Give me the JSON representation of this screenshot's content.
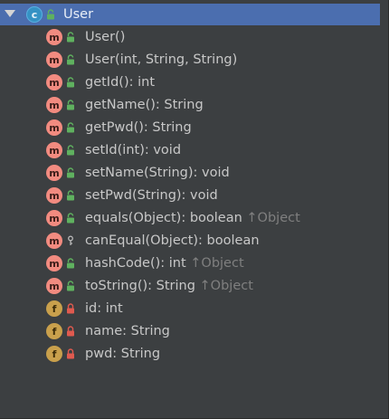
{
  "root": {
    "name": "User",
    "kind_letter": "c",
    "expanded": true
  },
  "members": [
    {
      "kind_letter": "m",
      "visibility": "public",
      "name": "User()",
      "inherited": ""
    },
    {
      "kind_letter": "m",
      "visibility": "public",
      "name": "User(int, String, String)",
      "inherited": ""
    },
    {
      "kind_letter": "m",
      "visibility": "public",
      "name": "getId(): int",
      "inherited": ""
    },
    {
      "kind_letter": "m",
      "visibility": "public",
      "name": "getName(): String",
      "inherited": ""
    },
    {
      "kind_letter": "m",
      "visibility": "public",
      "name": "getPwd(): String",
      "inherited": ""
    },
    {
      "kind_letter": "m",
      "visibility": "public",
      "name": "setId(int): void",
      "inherited": ""
    },
    {
      "kind_letter": "m",
      "visibility": "public",
      "name": "setName(String): void",
      "inherited": ""
    },
    {
      "kind_letter": "m",
      "visibility": "public",
      "name": "setPwd(String): void",
      "inherited": ""
    },
    {
      "kind_letter": "m",
      "visibility": "public",
      "name": "equals(Object): boolean",
      "inherited": "↑Object"
    },
    {
      "kind_letter": "m",
      "visibility": "protected",
      "name": "canEqual(Object): boolean",
      "inherited": ""
    },
    {
      "kind_letter": "m",
      "visibility": "public",
      "name": "hashCode(): int",
      "inherited": "↑Object"
    },
    {
      "kind_letter": "m",
      "visibility": "public",
      "name": "toString(): String",
      "inherited": "↑Object"
    },
    {
      "kind_letter": "f",
      "visibility": "private",
      "name": "id: int",
      "inherited": ""
    },
    {
      "kind_letter": "f",
      "visibility": "private",
      "name": "name: String",
      "inherited": ""
    },
    {
      "kind_letter": "f",
      "visibility": "private",
      "name": "pwd: String",
      "inherited": ""
    }
  ],
  "colors": {
    "background": "#3c3f41",
    "selection": "#4b6eaf",
    "class_badge": "#3592c4",
    "method_badge": "#f28b80",
    "field_badge": "#c9a04c",
    "public_lock": "#5fb15f",
    "private_lock": "#e05a4f",
    "inherited_text": "#7f7f7f"
  }
}
